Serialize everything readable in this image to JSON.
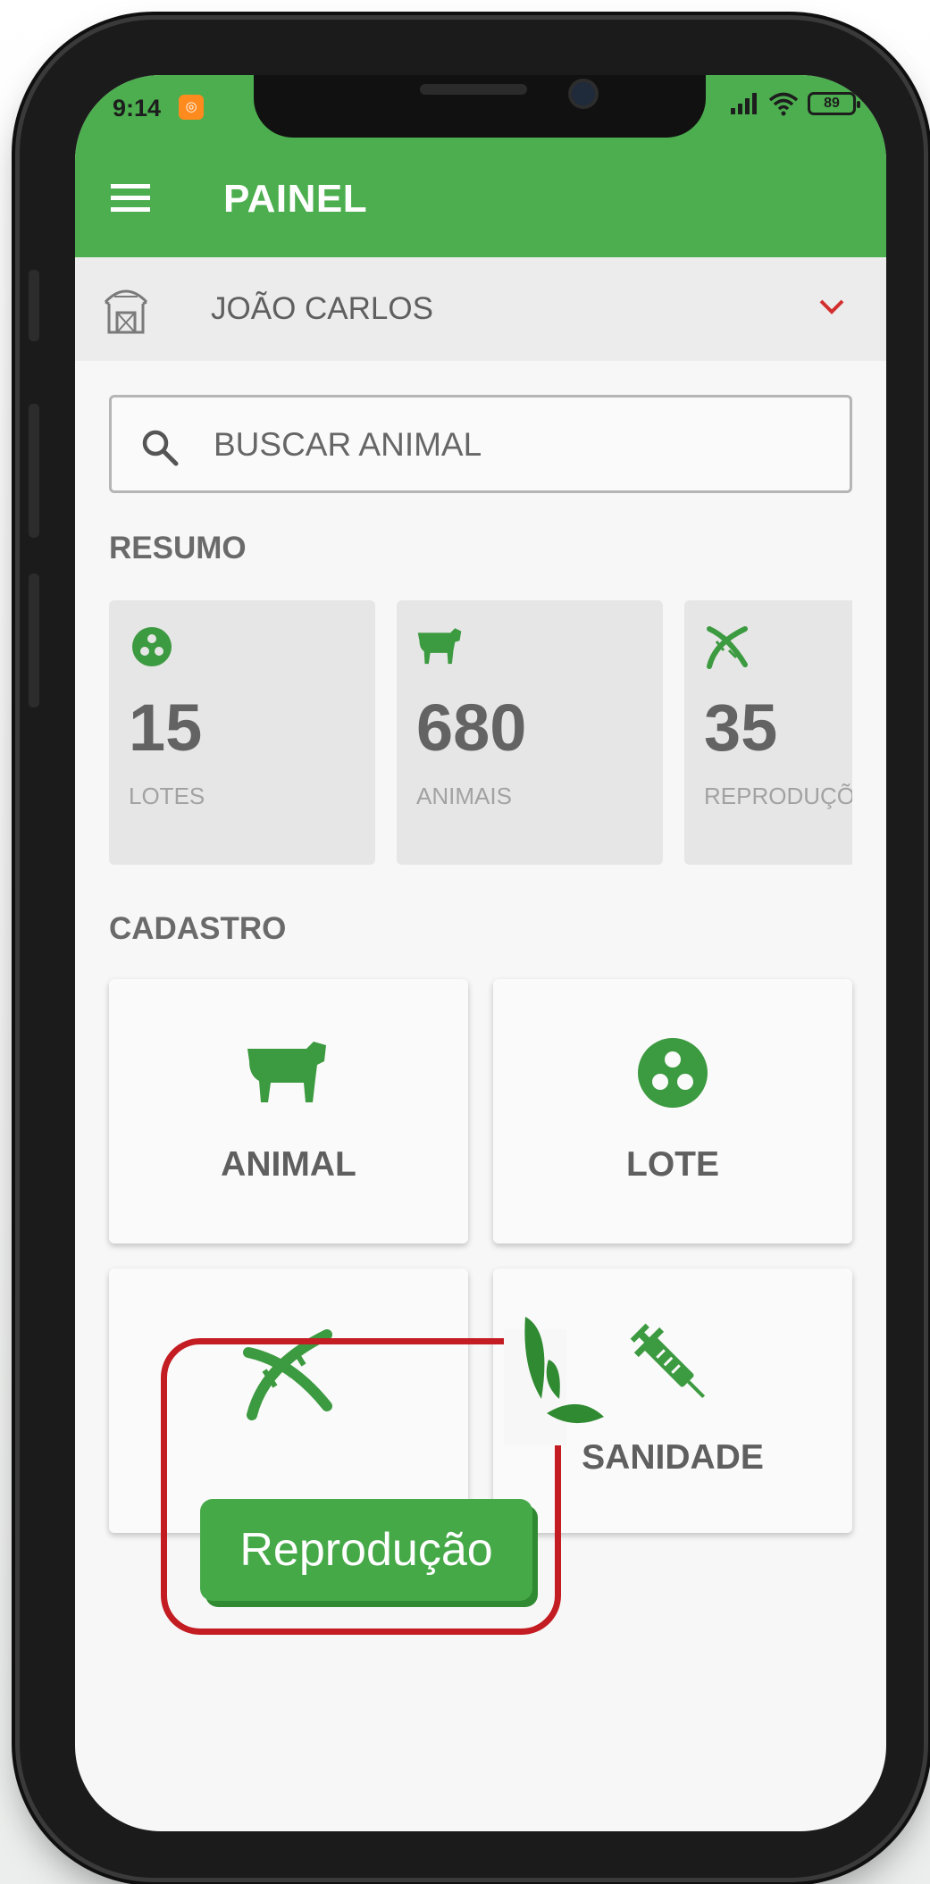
{
  "status_bar": {
    "time": "9:14",
    "battery": "89"
  },
  "app_bar": {
    "title": "PAINEL"
  },
  "farm_selector": {
    "name": "JOÃO CARLOS"
  },
  "search": {
    "placeholder": "BUSCAR ANIMAL"
  },
  "resumo": {
    "title": "RESUMO",
    "cards": [
      {
        "icon": "lot-circles-icon",
        "value": "15",
        "label": "LOTES"
      },
      {
        "icon": "cow-icon",
        "value": "680",
        "label": "ANIMAIS"
      },
      {
        "icon": "dna-icon",
        "value": "35",
        "label": "REPRODUÇÕES"
      }
    ]
  },
  "cadastro": {
    "title": "CADASTRO",
    "items": [
      {
        "icon": "cow-icon",
        "label": "ANIMAL"
      },
      {
        "icon": "lot-circles-icon",
        "label": "LOTE"
      },
      {
        "icon": "dna-icon",
        "label": "Reprodução"
      },
      {
        "icon": "syringe-icon",
        "label": "SANIDADE"
      }
    ]
  },
  "colors": {
    "primary_green": "#4cae4f",
    "icon_green": "#3c9a40",
    "highlight_red": "#c31c22",
    "splash_green": "#2f8a31"
  }
}
